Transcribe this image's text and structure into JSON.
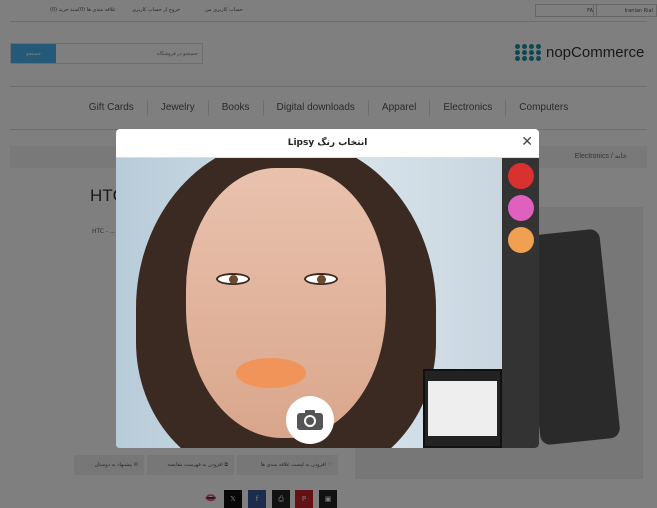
{
  "header": {
    "cart": "سبد خرید (0)",
    "wishlist": "علاقه مندی ها (0)",
    "logout": "خروج از حساب کاربری",
    "account": "حساب کاربری من",
    "language": "FA",
    "currency": "Iranian Rial"
  },
  "logo": {
    "text": "nopCommerce",
    "color": "#1b8fa3"
  },
  "search": {
    "placeholder": "جستجو در فروشگاه",
    "button": "جستجو"
  },
  "nav": [
    "Gift Cards",
    "Jewelry",
    "Books",
    "Digital downloads",
    "Apparel",
    "Electronics",
    "Computers"
  ],
  "breadcrumb": {
    "home": "خانه",
    "category": "Electronics"
  },
  "product": {
    "title": "HTC",
    "subtitle": "HTC - ..."
  },
  "actions": {
    "wishlist": "افزودن به لیست علاقه مندی ها",
    "compare": "افزودن به فهرست مقایسه",
    "email": "پیشنهاد به دوستان"
  },
  "share": {
    "x": "𝕏",
    "facebook": "f",
    "print": "⎙",
    "pinterest": "P",
    "other": "▣"
  },
  "modal": {
    "title": "انتخاب رنگ Lipsy",
    "close": "✕",
    "swatches": [
      "#d93030",
      "#e060c0",
      "#f0a050"
    ],
    "selected_lip_color": "#f0945a"
  }
}
